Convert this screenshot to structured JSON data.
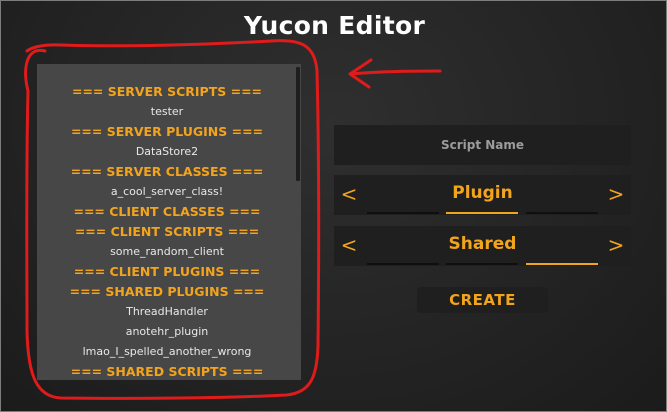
{
  "app": {
    "title": "Yucon Editor"
  },
  "script_list": {
    "rows": [
      {
        "text": "=== SERVER SCRIPTS ===",
        "kind": "header"
      },
      {
        "text": "tester",
        "kind": "item"
      },
      {
        "text": "=== SERVER PLUGINS ===",
        "kind": "header"
      },
      {
        "text": "DataStore2",
        "kind": "item"
      },
      {
        "text": "=== SERVER CLASSES ===",
        "kind": "header"
      },
      {
        "text": "a_cool_server_class!",
        "kind": "item"
      },
      {
        "text": "=== CLIENT CLASSES ===",
        "kind": "header"
      },
      {
        "text": "=== CLIENT SCRIPTS ===",
        "kind": "header"
      },
      {
        "text": "some_random_client",
        "kind": "item"
      },
      {
        "text": "=== CLIENT PLUGINS ===",
        "kind": "header"
      },
      {
        "text": "=== SHARED PLUGINS ===",
        "kind": "header"
      },
      {
        "text": "ThreadHandler",
        "kind": "item"
      },
      {
        "text": "anotehr_plugin",
        "kind": "item"
      },
      {
        "text": "lmao_I_spelled_another_wrong",
        "kind": "item"
      },
      {
        "text": "=== SHARED SCRIPTS ===",
        "kind": "header"
      }
    ]
  },
  "form": {
    "script_name_placeholder": "Script Name",
    "type_selector": {
      "prev": "<",
      "value": "Plugin",
      "next": ">",
      "selected_index": 1,
      "option_count": 3
    },
    "context_selector": {
      "prev": "<",
      "value": "Shared",
      "next": ">",
      "selected_index": 2,
      "option_count": 3
    },
    "create_label": "CREATE"
  },
  "colors": {
    "accent": "#f3a41d",
    "annotation": "#e01b1b",
    "panel": "#474747",
    "field": "#1f1f1f"
  }
}
